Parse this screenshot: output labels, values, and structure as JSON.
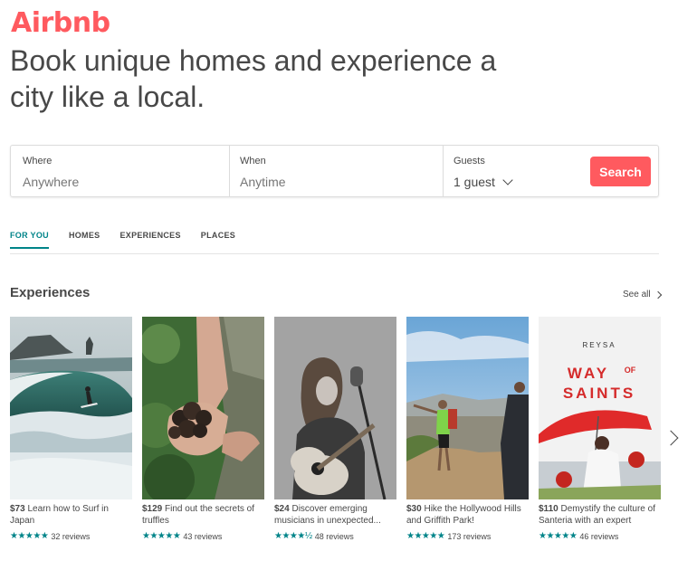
{
  "brand": {
    "logo": "Airbnb",
    "color": "#ff5a5f"
  },
  "headline": "Book unique homes and experience a city like a local.",
  "search": {
    "where_label": "Where",
    "where_value": "Anywhere",
    "when_label": "When",
    "when_value": "Anytime",
    "guests_label": "Guests",
    "guests_value": "1 guest",
    "button": "Search"
  },
  "tabs": [
    {
      "label": "FOR YOU",
      "active": true
    },
    {
      "label": "HOMES",
      "active": false
    },
    {
      "label": "EXPERIENCES",
      "active": false
    },
    {
      "label": "PLACES",
      "active": false
    }
  ],
  "section": {
    "title": "Experiences",
    "see_all": "See all"
  },
  "cards": [
    {
      "price": "$73",
      "title": "Learn how to Surf in Japan",
      "stars": "★★★★★",
      "reviews": "32 reviews",
      "image": "surfer-wave"
    },
    {
      "price": "$129",
      "title": "Find out the secrets of truffles",
      "stars": "★★★★★",
      "reviews": "43 reviews",
      "image": "truffles-hands"
    },
    {
      "price": "$24",
      "title": "Discover emerging musicians in unexpected...",
      "stars": "★★★★½",
      "reviews": "48 reviews",
      "image": "guitarist"
    },
    {
      "price": "$30",
      "title": "Hike the Hollywood Hills and Griffith Park!",
      "stars": "★★★★★",
      "reviews": "173 reviews",
      "image": "hikers"
    },
    {
      "price": "$110",
      "title": "Demystify the culture of Santeria with an expert",
      "stars": "★★★★★",
      "reviews": "46 reviews",
      "image": "way-of-saints-poster",
      "poster_brand": "REYSA",
      "poster_title_1": "WAY",
      "poster_title_of": "OF",
      "poster_title_2": "SAINTS"
    }
  ],
  "colors": {
    "accent": "#008489",
    "text": "#484848"
  }
}
